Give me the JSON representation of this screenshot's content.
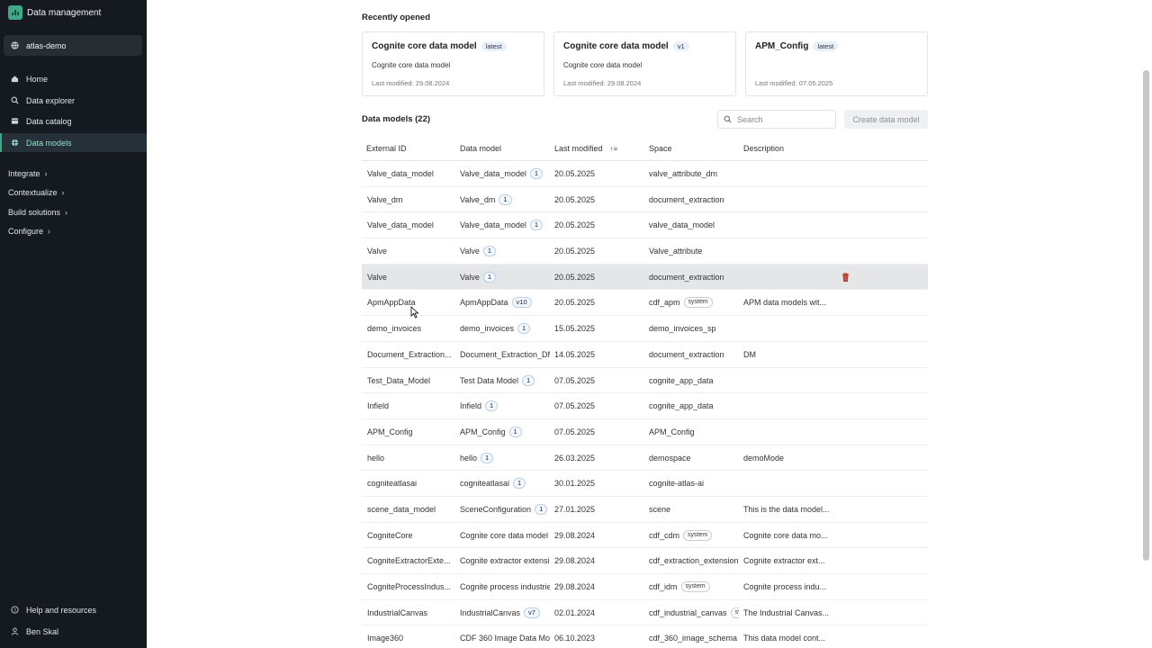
{
  "app": {
    "title": "Data management"
  },
  "sidebar": {
    "project": "atlas-demo",
    "nav": [
      {
        "label": "Home",
        "icon": "home-icon"
      },
      {
        "label": "Data explorer",
        "icon": "search-icon"
      },
      {
        "label": "Data catalog",
        "icon": "catalog-icon"
      },
      {
        "label": "Data models",
        "icon": "data-models-icon",
        "active": true
      }
    ],
    "sections": [
      "Integrate",
      "Contextualize",
      "Build solutions",
      "Configure"
    ],
    "footer": {
      "help": "Help and resources",
      "user": "Ben Skal"
    }
  },
  "recent": {
    "title": "Recently opened",
    "cards": [
      {
        "title": "Cognite core data model",
        "badge": "latest",
        "subtitle": "Cognite core data model",
        "date": "Last modified: 29.08.2024"
      },
      {
        "title": "Cognite core data model",
        "badge": "v1",
        "subtitle": "Cognite core data model",
        "date": "Last modified: 29.08.2024"
      },
      {
        "title": "APM_Config",
        "badge": "latest",
        "subtitle": "",
        "date": "Last modified: 07.05.2025"
      }
    ]
  },
  "models": {
    "title": "Data models (22)",
    "search_placeholder": "Search",
    "create_label": "Create data model",
    "columns": [
      "External ID",
      "Data model",
      "Last modified",
      "Space",
      "Description"
    ],
    "rows": [
      {
        "ext": "Valve_data_model",
        "dm": "Valve_data_model",
        "ver": "1",
        "mod": "20.05.2025",
        "space": "valve_attribute_dm",
        "sys": "",
        "desc": ""
      },
      {
        "ext": "Valve_dm",
        "dm": "Valve_dm",
        "ver": "1",
        "mod": "20.05.2025",
        "space": "document_extraction",
        "sys": "",
        "desc": ""
      },
      {
        "ext": "Valve_data_model",
        "dm": "Valve_data_model",
        "ver": "1",
        "mod": "20.05.2025",
        "space": "valve_data_model",
        "sys": "",
        "desc": ""
      },
      {
        "ext": "Valve",
        "dm": "Valve",
        "ver": "1",
        "mod": "20.05.2025",
        "space": "Valve_attribute",
        "sys": "",
        "desc": ""
      },
      {
        "ext": "Valve",
        "dm": "Valve",
        "ver": "1",
        "mod": "20.05.2025",
        "space": "document_extraction",
        "sys": "",
        "desc": "",
        "hover": true
      },
      {
        "ext": "ApmAppData",
        "dm": "ApmAppData",
        "ver": "v10",
        "mod": "20.05.2025",
        "space": "cdf_apm",
        "sys": "system",
        "desc": "APM data models wit..."
      },
      {
        "ext": "demo_invoices",
        "dm": "demo_invoices",
        "ver": "1",
        "mod": "15.05.2025",
        "space": "demo_invoices_sp",
        "sys": "",
        "desc": ""
      },
      {
        "ext": "Document_Extraction...",
        "dm": "Document_Extraction_DM",
        "ver": "",
        "mod": "14.05.2025",
        "space": "document_extraction",
        "sys": "",
        "desc": "DM"
      },
      {
        "ext": "Test_Data_Model",
        "dm": "Test Data Model",
        "ver": "1",
        "mod": "07.05.2025",
        "space": "cognite_app_data",
        "sys": "",
        "desc": ""
      },
      {
        "ext": "Infield",
        "dm": "Infield",
        "ver": "1",
        "mod": "07.05.2025",
        "space": "cognite_app_data",
        "sys": "",
        "desc": ""
      },
      {
        "ext": "APM_Config",
        "dm": "APM_Config",
        "ver": "1",
        "mod": "07.05.2025",
        "space": "APM_Config",
        "sys": "",
        "desc": ""
      },
      {
        "ext": "hello",
        "dm": "hello",
        "ver": "1",
        "mod": "26.03.2025",
        "space": "demospace",
        "sys": "",
        "desc": "demoMode"
      },
      {
        "ext": "cogniteatlasai",
        "dm": "cogniteatlasai",
        "ver": "1",
        "mod": "30.01.2025",
        "space": "cognite-atlas-ai",
        "sys": "",
        "desc": ""
      },
      {
        "ext": "scene_data_model",
        "dm": "SceneConfiguration",
        "ver": "1",
        "mod": "27.01.2025",
        "space": "scene",
        "sys": "",
        "desc": "This is the data model..."
      },
      {
        "ext": "CogniteCore",
        "dm": "Cognite core data model",
        "ver": "",
        "mod": "29.08.2024",
        "space": "cdf_cdm",
        "sys": "system",
        "desc": "Cognite core data mo..."
      },
      {
        "ext": "CogniteExtractorExte...",
        "dm": "Cognite extractor extensi",
        "ver": "",
        "mod": "29.08.2024",
        "space": "cdf_extraction_extension",
        "sys": "",
        "desc": "Cognite extractor ext..."
      },
      {
        "ext": "CogniteProcessIndus...",
        "dm": "Cognite process industrie",
        "ver": "",
        "mod": "29.08.2024",
        "space": "cdf_idm",
        "sys": "system",
        "desc": "Cognite process indu..."
      },
      {
        "ext": "IndustrialCanvas",
        "dm": "IndustrialCanvas",
        "ver": "v7",
        "mod": "02.01.2024",
        "space": "cdf_industrial_canvas",
        "sys": "sy",
        "desc": "The Industrial Canvas..."
      },
      {
        "ext": "Image360",
        "dm": "CDF 360 Image Data Mo",
        "ver": "",
        "mod": "06.10.2023",
        "space": "cdf_360_image_schema",
        "sys": "",
        "desc": "This data model cont..."
      }
    ]
  },
  "colors": {
    "sidebar_bg": "#141a1f",
    "accent": "#3fa886",
    "danger": "#c0392b"
  }
}
